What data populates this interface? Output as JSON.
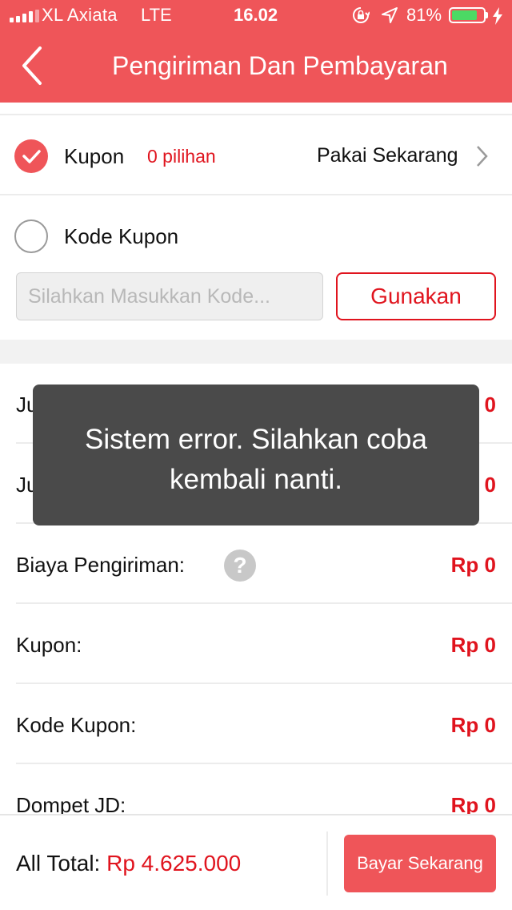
{
  "status_bar": {
    "carrier": "XL Axiata",
    "network": "LTE",
    "time": "16.02",
    "battery_percent": "81%",
    "battery_level": 0.81,
    "icons": [
      "signal-icon",
      "orientation-lock-icon",
      "location-icon",
      "battery-icon",
      "charging-bolt-icon"
    ]
  },
  "header": {
    "title": "Pengiriman Dan Pembayaran",
    "back_icon": "chevron-left-icon",
    "color": "#ef5559"
  },
  "coupon": {
    "checked": true,
    "label": "Kupon",
    "options": "0 pilihan",
    "action": "Pakai Sekarang"
  },
  "coupon_code": {
    "checked": false,
    "label": "Kode Kupon",
    "placeholder": "Silahkan Masukkan Kode...",
    "value": "",
    "button": "Gunakan"
  },
  "summary": {
    "rows": [
      {
        "label": "Ju",
        "amount": "0"
      },
      {
        "label": "Ju",
        "amount": "0"
      },
      {
        "label": "Biaya Pengiriman:",
        "amount": "Rp 0"
      },
      {
        "label": "Kupon:",
        "amount": "Rp 0"
      },
      {
        "label": "Kode Kupon:",
        "amount": "Rp 0"
      },
      {
        "label": "Dompet JD:",
        "amount": "Rp 0"
      }
    ],
    "help_icon": "?"
  },
  "toast": {
    "message": "Sistem error. Silahkan coba kembali nanti."
  },
  "footer": {
    "total_label": "All Total:",
    "total_value": "Rp 4.625.000",
    "pay_button": "Bayar Sekarang"
  },
  "colors": {
    "accent": "#ef5559",
    "price_red": "#e0141e",
    "toast_bg": "#4a4a4a"
  }
}
